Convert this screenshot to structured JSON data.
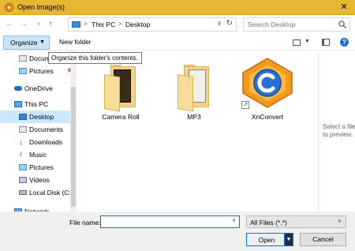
{
  "titlebar": {
    "title": "Open Image(s)",
    "close_glyph": "✕"
  },
  "nav": {
    "back_glyph": "←",
    "forward_glyph": "→",
    "recent_glyph": "∨",
    "up_glyph": "↑"
  },
  "address": {
    "crumbs": [
      "This PC",
      "Desktop"
    ],
    "separator": ">"
  },
  "search": {
    "placeholder": "Search Desktop"
  },
  "toolbar": {
    "organize_label": "Organize",
    "new_folder_label": "New folder",
    "help_glyph": "?"
  },
  "tooltip": {
    "text": "Organize this folder's contents."
  },
  "sidebar": {
    "items": [
      {
        "label": "Docum",
        "icon": "documents-folder-icon"
      },
      {
        "label": "Pictures",
        "icon": "pictures-folder-icon"
      },
      {
        "label": "OneDrive",
        "icon": "cloud-icon"
      },
      {
        "label": "This PC",
        "icon": "computer-icon"
      },
      {
        "label": "Desktop",
        "icon": "desktop-icon",
        "selected": true
      },
      {
        "label": "Documents",
        "icon": "documents-folder-icon"
      },
      {
        "label": "Downloads",
        "icon": "download-arrow-icon"
      },
      {
        "label": "Music",
        "icon": "music-note-icon"
      },
      {
        "label": "Pictures",
        "icon": "pictures-folder-icon"
      },
      {
        "label": "Videos",
        "icon": "videos-folder-icon"
      },
      {
        "label": "Local Disk (C:)",
        "icon": "drive-icon"
      },
      {
        "label": "Network",
        "icon": "network-icon"
      }
    ]
  },
  "files": [
    {
      "name": "Camera Roll",
      "icon": "folder-icon"
    },
    {
      "name": "MP3",
      "icon": "folder-icon"
    },
    {
      "name": "XnConvert",
      "icon": "xnconvert-shortcut-icon"
    }
  ],
  "preview": {
    "text": "Select a file to preview."
  },
  "footer": {
    "filename_label": "File name:",
    "filename_value": "",
    "filetype_value": "All Files (*.*)",
    "open_label": "Open",
    "cancel_label": "Cancel"
  },
  "colors": {
    "titlebar": "#e7b731",
    "selection": "#cce8ff",
    "accent": "#0078d7"
  }
}
